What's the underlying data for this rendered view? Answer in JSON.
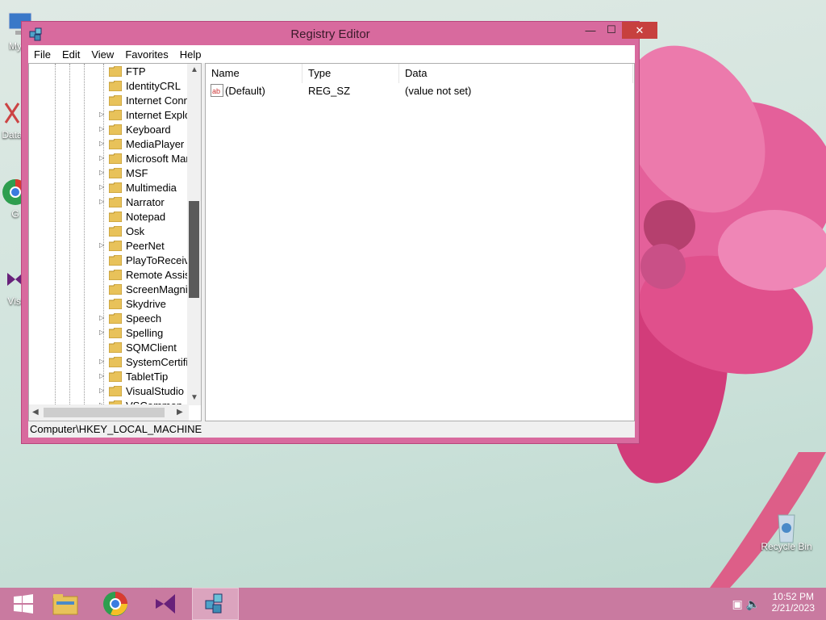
{
  "window": {
    "title": "Registry Editor",
    "buttons": {
      "minimize": "—",
      "maximize": "☐",
      "close": "✕"
    }
  },
  "menu": [
    "File",
    "Edit",
    "View",
    "Favorites",
    "Help"
  ],
  "tree": {
    "items": [
      {
        "label": "FTP",
        "expandable": false
      },
      {
        "label": "IdentityCRL",
        "expandable": false
      },
      {
        "label": "Internet Conne",
        "expandable": false
      },
      {
        "label": "Internet Explor",
        "expandable": true
      },
      {
        "label": "Keyboard",
        "expandable": true
      },
      {
        "label": "MediaPlayer",
        "expandable": true
      },
      {
        "label": "Microsoft Mar",
        "expandable": true
      },
      {
        "label": "MSF",
        "expandable": true
      },
      {
        "label": "Multimedia",
        "expandable": true
      },
      {
        "label": "Narrator",
        "expandable": true
      },
      {
        "label": "Notepad",
        "expandable": false
      },
      {
        "label": "Osk",
        "expandable": false
      },
      {
        "label": "PeerNet",
        "expandable": true
      },
      {
        "label": "PlayToReceive",
        "expandable": false
      },
      {
        "label": "Remote Assista",
        "expandable": false
      },
      {
        "label": "ScreenMagnifi",
        "expandable": false
      },
      {
        "label": "Skydrive",
        "expandable": false
      },
      {
        "label": "Speech",
        "expandable": true
      },
      {
        "label": "Spelling",
        "expandable": true
      },
      {
        "label": "SQMClient",
        "expandable": false
      },
      {
        "label": "SystemCertific",
        "expandable": true
      },
      {
        "label": "TabletTip",
        "expandable": true
      },
      {
        "label": "VisualStudio",
        "expandable": true
      },
      {
        "label": "VSCommon",
        "expandable": true
      }
    ]
  },
  "list": {
    "columns": [
      "Name",
      "Type",
      "Data"
    ],
    "rows": [
      {
        "name": "(Default)",
        "type": "REG_SZ",
        "data": "(value not set)"
      }
    ]
  },
  "statusbar": {
    "path": "Computer\\HKEY_LOCAL_MACHINE"
  },
  "desktop": {
    "icons": [
      {
        "label": "My C",
        "icon": "computer-icon"
      },
      {
        "label": "Data",
        "icon": "database-icon"
      },
      {
        "label": "G",
        "icon": "chrome-icon"
      },
      {
        "label": "Visu",
        "icon": "visual-studio-icon"
      },
      {
        "label": "Recycle Bin",
        "icon": "recycle-bin-icon"
      }
    ]
  },
  "taskbar": {
    "apps": [
      "start-icon",
      "file-explorer-icon",
      "chrome-icon",
      "visual-studio-icon",
      "registry-editor-icon"
    ],
    "time": "10:52 PM",
    "date": "2/21/2023"
  },
  "colors": {
    "accent": "#d86a9e",
    "taskbar": "#c97aa0",
    "close": "#c7403e"
  }
}
